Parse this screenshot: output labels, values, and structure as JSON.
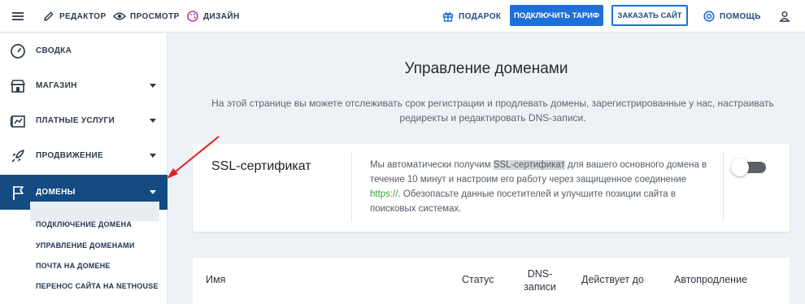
{
  "topbar": {
    "editor": "РЕДАКТОР",
    "preview": "ПРОСМОТР",
    "design": "ДИЗАЙН",
    "gift": "ПОДАРОК",
    "connect_plan": "ПОДКЛЮЧИТЬ ТАРИФ",
    "order_site": "ЗАКАЗАТЬ САЙТ",
    "help": "ПОМОЩЬ"
  },
  "sidebar": {
    "items": [
      {
        "label": "СВОДКА",
        "icon": "dashboard-icon"
      },
      {
        "label": "МАГАЗИН",
        "icon": "store-icon"
      },
      {
        "label": "ПЛАТНЫЕ УСЛУГИ",
        "icon": "paid-services-icon"
      },
      {
        "label": "ПРОДВИЖЕНИЕ",
        "icon": "rocket-icon"
      },
      {
        "label": "ДОМЕНЫ",
        "icon": "flag-icon"
      }
    ],
    "sub_items": [
      "ПОДКЛЮЧЕНИЕ ДОМЕНА",
      "УПРАВЛЕНИЕ ДОМЕНАМИ",
      "ПОЧТА НА ДОМЕНЕ",
      "ПЕРЕНОС САЙТА НА NETHOUSE"
    ]
  },
  "main": {
    "title": "Управление доменами",
    "description": "На этой странице вы можете отслеживать срок регистрации и продлевать домены, зарегистрированные у нас, настраивать редиректы и редактировать DNS-записи.",
    "ssl_card": {
      "title": "SSL-сертификат",
      "text_1": "Мы автоматически получим ",
      "text_hl": "SSL-сертификат",
      "text_2": " для вашего основного домена в течение 10 минут и настроим его работу через защищенное соединение ",
      "text_link": "https://",
      "text_3": ". Обезопасьте данные посетителей и улучшите позиции сайта в поисковых системах.",
      "toggle_on": false
    },
    "table": {
      "columns": [
        "Имя",
        "Статус",
        "DNS-записи",
        "Действует до",
        "Автопродление"
      ]
    }
  },
  "colors": {
    "accent": "#1f6fd6",
    "active_nav": "#134b82",
    "arrow": "#e02020"
  }
}
